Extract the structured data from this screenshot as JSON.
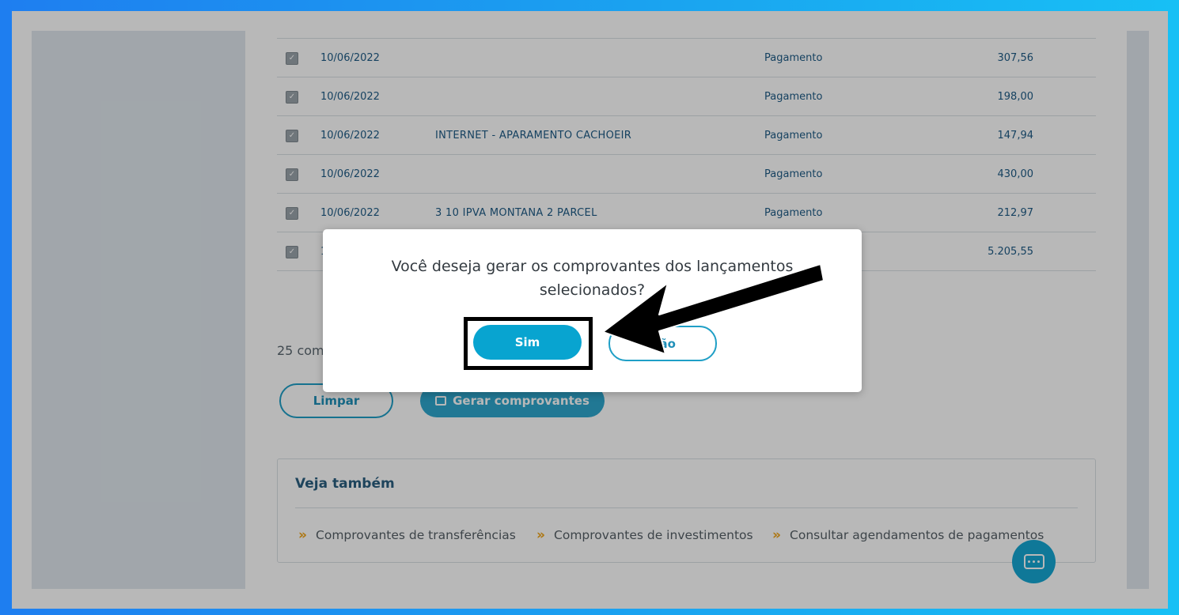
{
  "rows": [
    {
      "date": "10/06/2022",
      "description": "",
      "type": "Pagamento",
      "value": "307,56"
    },
    {
      "date": "10/06/2022",
      "description": "",
      "type": "Pagamento",
      "value": "198,00"
    },
    {
      "date": "10/06/2022",
      "description": "INTERNET - APARAMENTO CACHOEIR",
      "type": "Pagamento",
      "value": "147,94"
    },
    {
      "date": "10/06/2022",
      "description": "",
      "type": "Pagamento",
      "value": "430,00"
    },
    {
      "date": "10/06/2022",
      "description": "3 10 IPVA MONTANA 2 PARCEL",
      "type": "Pagamento",
      "value": "212,97"
    },
    {
      "date": "1",
      "description": "",
      "type": "",
      "value": "5.205,55"
    }
  ],
  "count_text": "25 comp",
  "buttons": {
    "clear": "Limpar",
    "generate": "Gerar comprovantes"
  },
  "see_also": {
    "title": "Veja também",
    "links": [
      "Comprovantes de transferências",
      "Comprovantes de investimentos",
      "Consultar agendamentos de pagamentos"
    ]
  },
  "modal": {
    "message": "Você deseja gerar os comprovantes dos lançamentos selecionados?",
    "yes": "Sim",
    "no": "Não"
  },
  "icons": {
    "checkbox": "checkmark-icon",
    "generate": "export-icon",
    "chevron": "double-chevron-right-icon",
    "chat": "chat-icon",
    "annotation": "arrow-annotation"
  },
  "colors": {
    "brand": "#08a4d0",
    "accent": "#f0a51a",
    "text_blue": "#1e5b86"
  }
}
